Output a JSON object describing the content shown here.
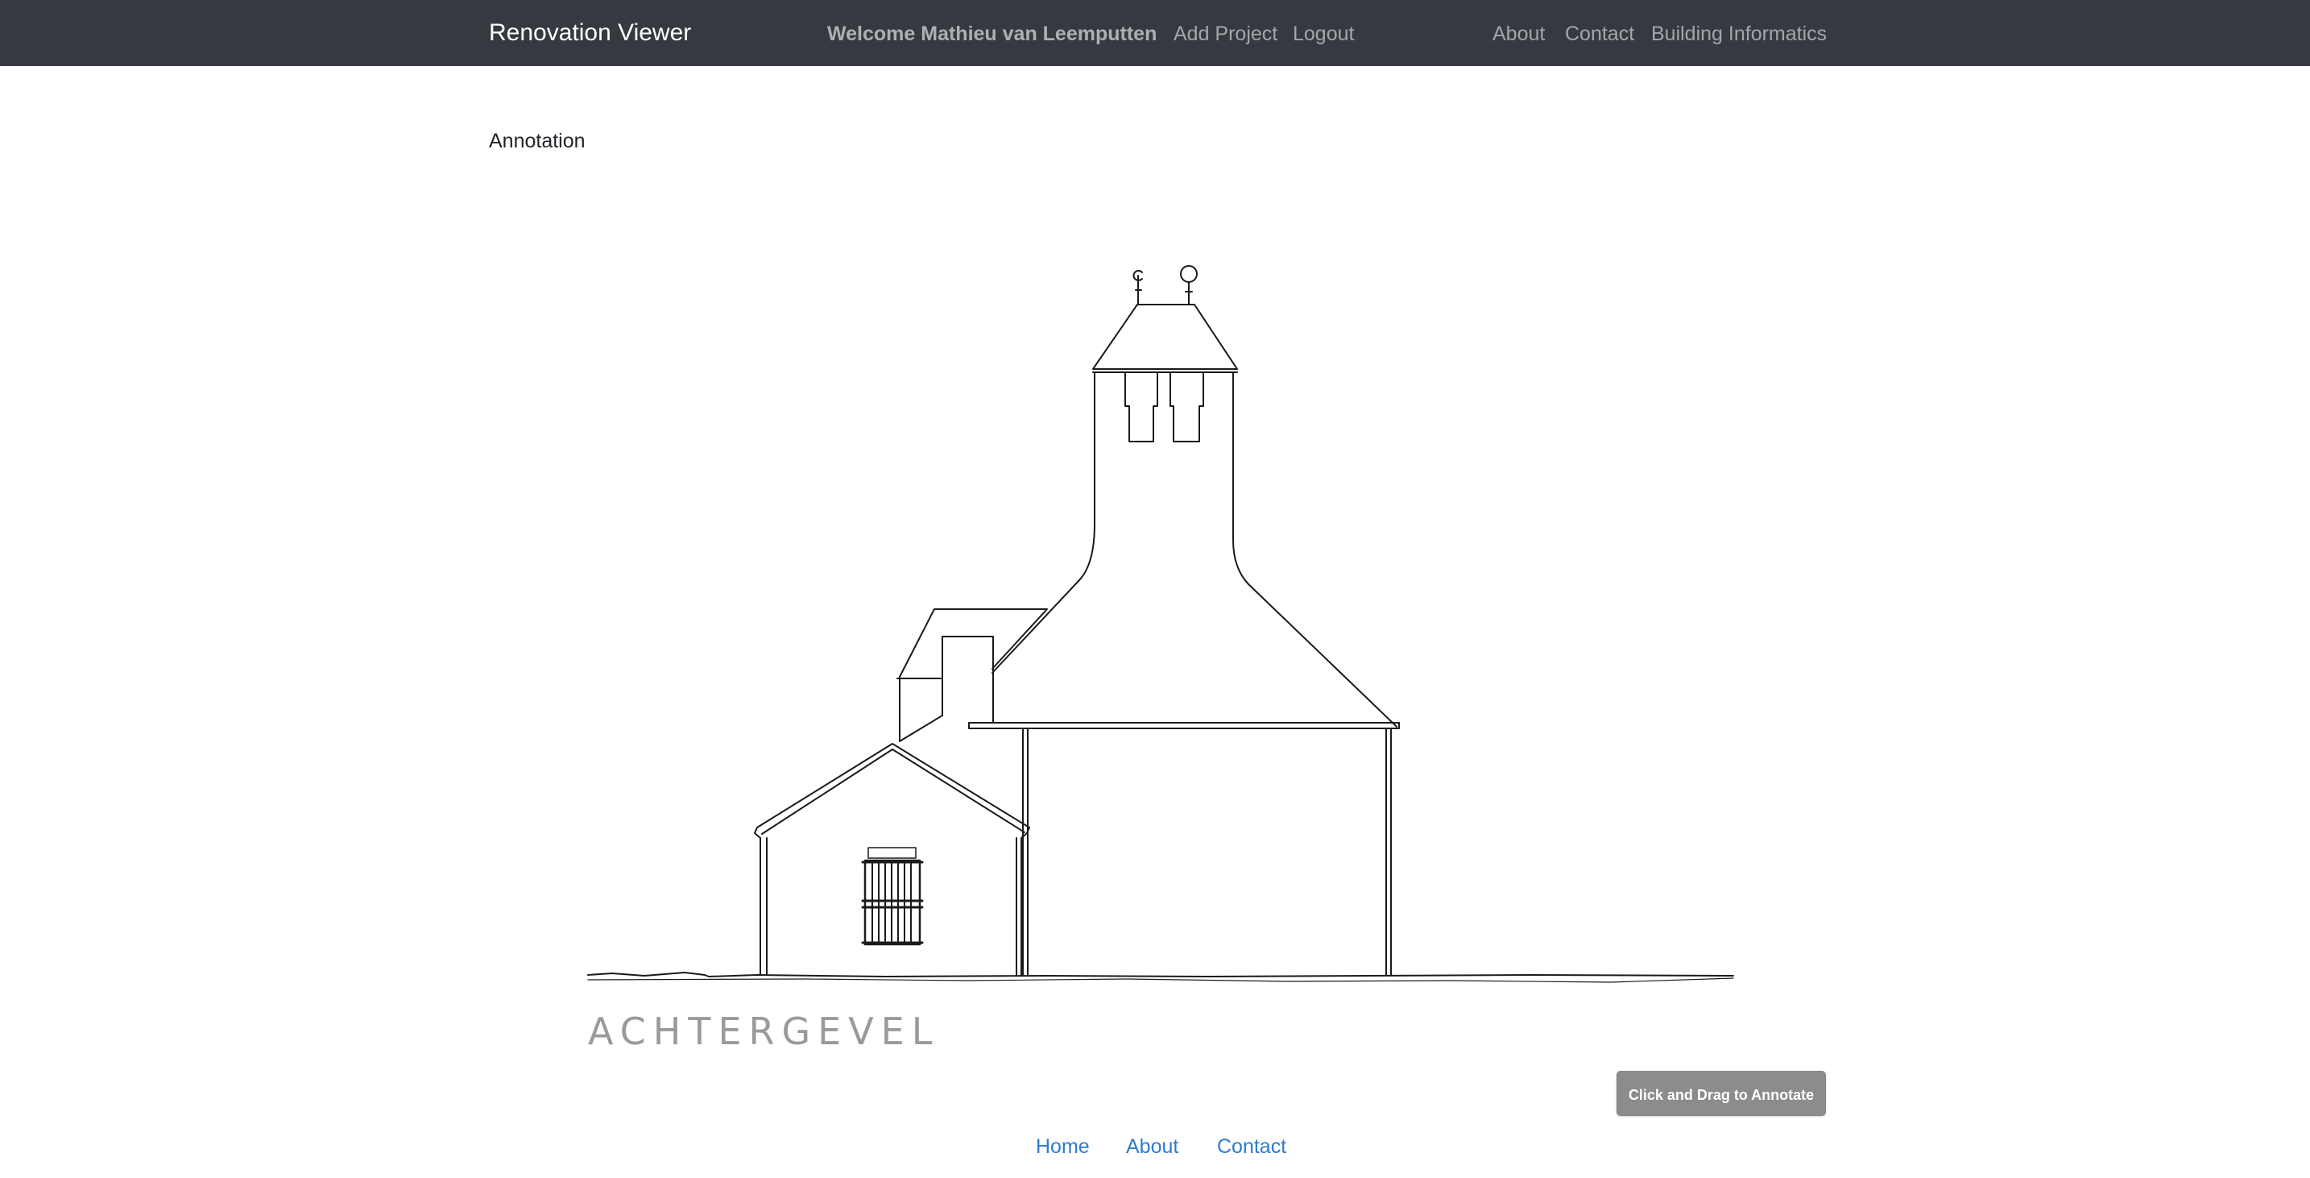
{
  "navbar": {
    "brand": "Renovation Viewer",
    "welcome": "Welcome Mathieu van Leemputten",
    "add_project": "Add Project",
    "logout": "Logout",
    "about": "About",
    "contact": "Contact",
    "building_informatics": "Building Informatics"
  },
  "page": {
    "title": "Annotation"
  },
  "drawing": {
    "title": "ACHTERGEVEL"
  },
  "annotate_button": {
    "label": "Click and Drag to Annotate"
  },
  "footer": {
    "home": "Home",
    "about": "About",
    "contact": "Contact"
  },
  "colors": {
    "navbar_bg": "#343a40",
    "link": "#2e7bd1",
    "annotate_button_bg": "#8c8c8c"
  }
}
